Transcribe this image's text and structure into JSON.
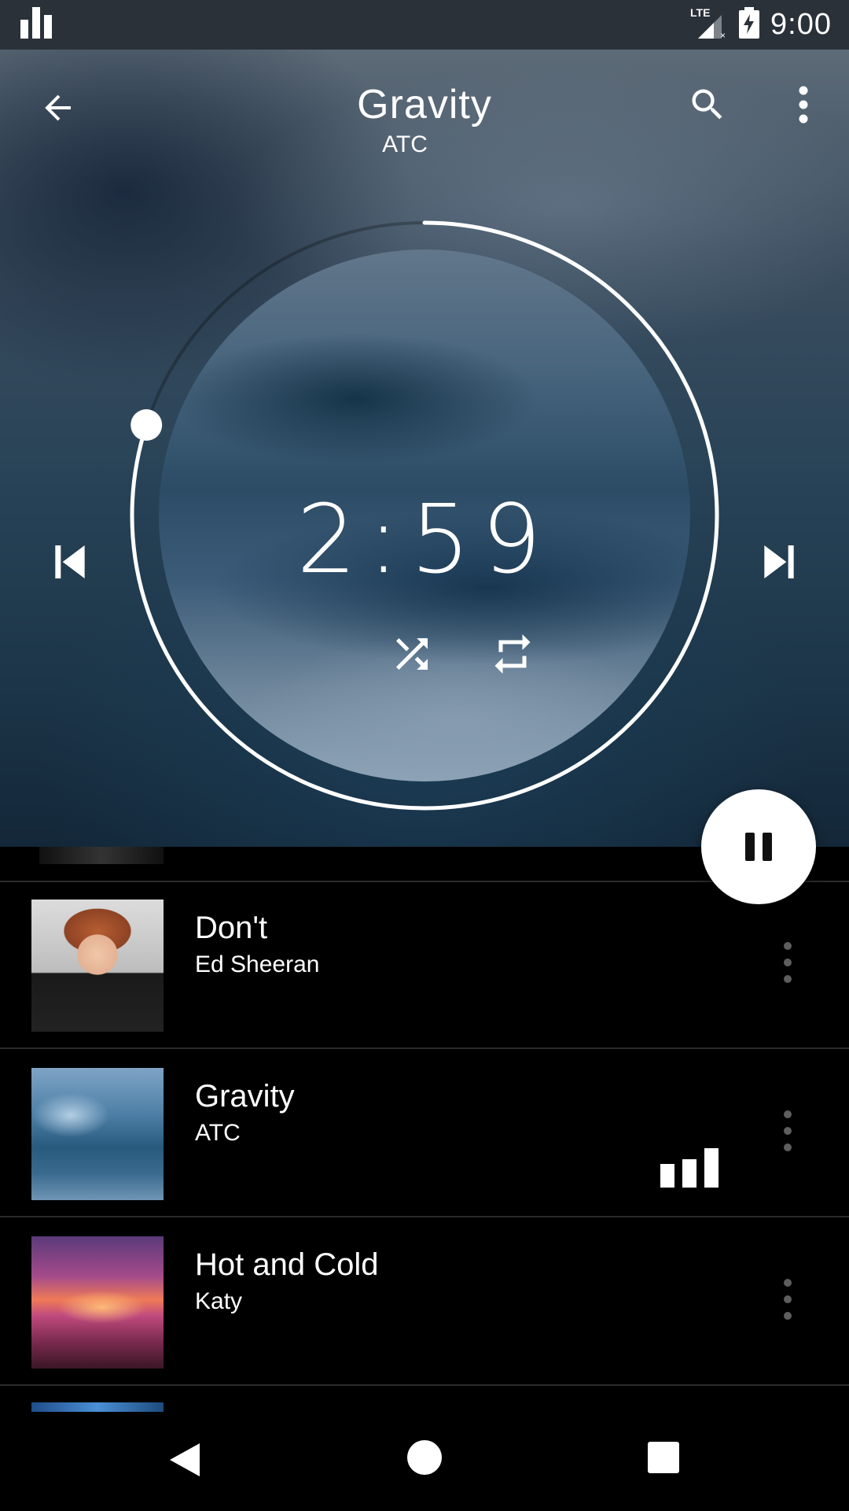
{
  "status_bar": {
    "time": "9:00",
    "network": "LTE",
    "icons": [
      "equalizer-app-icon",
      "lte-signal-icon",
      "battery-charging-icon"
    ]
  },
  "header": {
    "title": "Gravity",
    "artist": "ATC",
    "icons": [
      "back-arrow-icon",
      "search-icon",
      "more-vert-icon"
    ]
  },
  "player": {
    "elapsed": "2:59",
    "controls": [
      "skip-previous-icon",
      "shuffle-icon",
      "repeat-icon",
      "skip-next-icon",
      "pause-icon"
    ],
    "progress": 0.8
  },
  "songs": [
    {
      "title": "Don't",
      "artist": "Ed Sheeran",
      "playing": false
    },
    {
      "title": "Gravity",
      "artist": "ATC",
      "playing": true
    },
    {
      "title": "Hot and Cold",
      "artist": "Katy",
      "playing": false
    }
  ],
  "colors": {
    "accent": "#ffffff",
    "list_background": "#000000",
    "divider": "#2a2a2a"
  }
}
